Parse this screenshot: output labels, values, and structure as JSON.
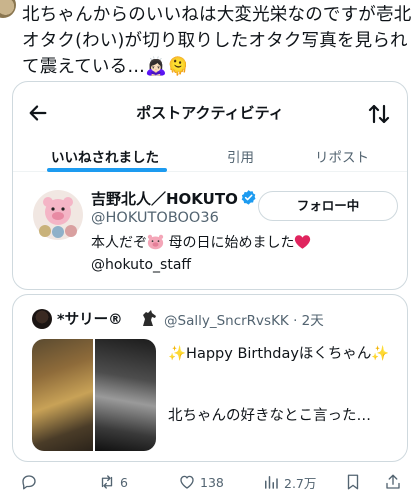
{
  "post": {
    "text": "北ちゃんからのいいねは大変光栄なのですが壱北オタク(わい)が切り取りしたオタク写真を見られて震えている…🙇🏻‍♀️🫠"
  },
  "activity": {
    "title": "ポストアクティビティ",
    "tabs": [
      {
        "label": "いいねされました",
        "active": true
      },
      {
        "label": "引用",
        "active": false
      },
      {
        "label": "リポスト",
        "active": false
      }
    ]
  },
  "user": {
    "name": "吉野北人／HOKUTO",
    "handle": "@HOKUTOBOO36",
    "follow_label": "フォロー中",
    "bio_line1_a": "本人だぞ",
    "bio_line1_b": "母の日に始めました",
    "bio_line2": "@hokuto_staff"
  },
  "tweet": {
    "author": "*サリー®",
    "handle_time": "@Sally_SncrRvsKK · 2天",
    "line1": "✨Happy Birthdayほくちゃん✨",
    "line2": "北ちゃんの好きなとこ言った…"
  },
  "actions": {
    "reposts": "6",
    "likes": "138",
    "views": "2.7万"
  },
  "colors": {
    "accent": "#1d9bf0",
    "muted": "#536471",
    "text": "#0f1419",
    "border": "#cfd9de"
  },
  "icons": [
    "back-arrow-icon",
    "sort-icon",
    "verified-icon",
    "pig-emoji-icon",
    "heart-emoji-icon",
    "horse-icon",
    "reply-icon",
    "repost-icon",
    "like-icon",
    "views-icon",
    "bookmark-icon",
    "share-icon"
  ]
}
